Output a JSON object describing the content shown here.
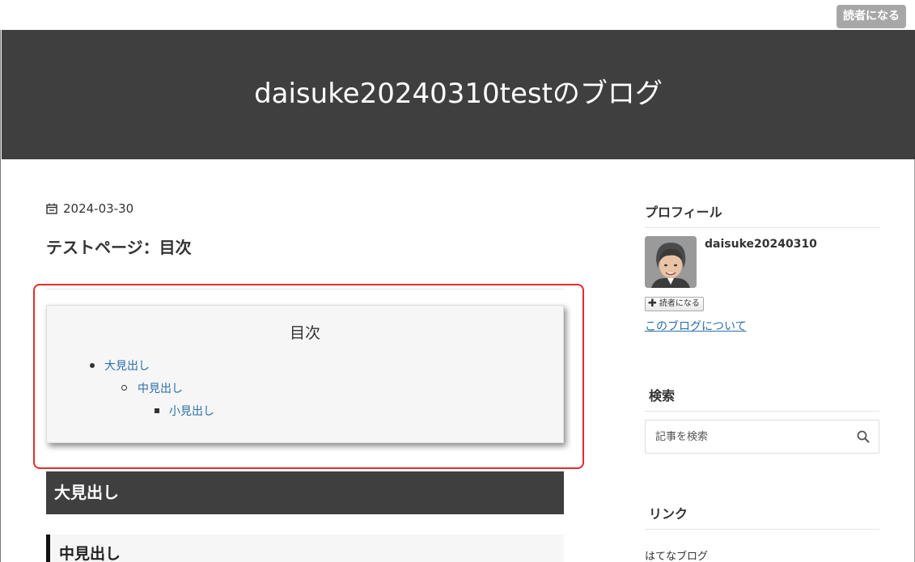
{
  "topbar": {
    "subscribe_label": "読者になる"
  },
  "header": {
    "blog_title": "daisuke20240310testのブログ"
  },
  "entry": {
    "date": "2024-03-30",
    "title": "テストページ：目次",
    "toc": {
      "title": "目次",
      "items": [
        {
          "label": "大見出し",
          "level": 1
        },
        {
          "label": "中見出し",
          "level": 2
        },
        {
          "label": "小見出し",
          "level": 3
        }
      ]
    },
    "heading_large": "大見出し",
    "heading_mid": "中見出し"
  },
  "sidebar": {
    "profile": {
      "heading": "プロフィール",
      "name": "daisuke20240310",
      "subscribe_label": "読者になる",
      "about_link": "このブログについて"
    },
    "search": {
      "heading": "検索",
      "placeholder": "記事を検索"
    },
    "links": {
      "heading": "リンク",
      "items": [
        "はてなブログ"
      ]
    }
  },
  "colors": {
    "header_bg": "#3f3f3f",
    "highlight_border": "#e52b2b",
    "link": "#2a6fa8"
  }
}
